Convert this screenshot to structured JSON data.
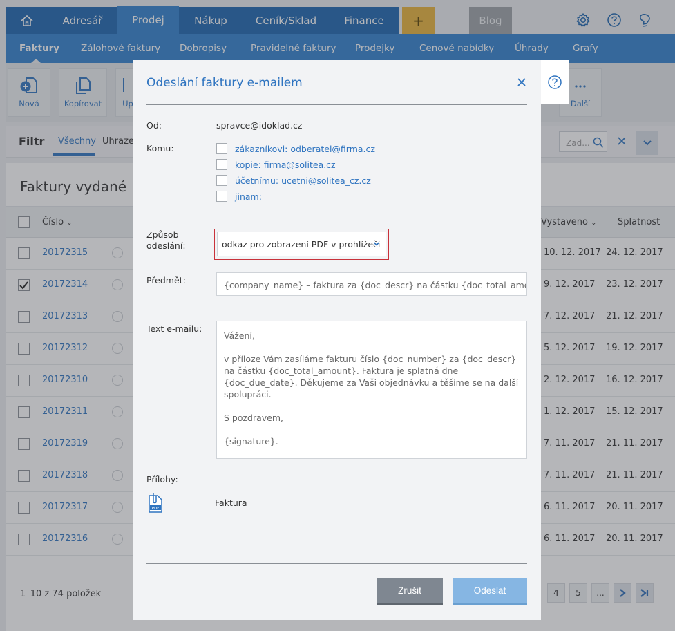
{
  "nav": {
    "home_icon": "home-icon",
    "items": [
      {
        "label": "Adresář"
      },
      {
        "label": "Prodej"
      },
      {
        "label": "Nákup"
      },
      {
        "label": "Ceník/Sklad"
      },
      {
        "label": "Finance"
      }
    ],
    "plus": "+",
    "blog": "Blog",
    "icons": [
      "gear-icon",
      "help-icon",
      "bulb-icon"
    ]
  },
  "subnav": {
    "items": [
      {
        "label": "Faktury"
      },
      {
        "label": "Zálohové faktury"
      },
      {
        "label": "Dobropisy"
      },
      {
        "label": "Pravidelné faktury"
      },
      {
        "label": "Prodejky"
      },
      {
        "label": "Cenové nabídky"
      },
      {
        "label": "Úhrady"
      },
      {
        "label": "Grafy"
      }
    ]
  },
  "toolbar": {
    "new_label": "Nová",
    "copy_label": "Kopírovat",
    "edit_label": "Up",
    "more_label": "Další"
  },
  "filter": {
    "title": "Filtr",
    "tab_all": "Všechny",
    "tab_paid": "Uhrazen",
    "search_placeholder": "Zad..."
  },
  "list": {
    "title": "Faktury vydané",
    "col_number": "Číslo",
    "col_issued": "Vystaveno",
    "col_due": "Splatnost",
    "rows": [
      {
        "number": "20172315",
        "issued": "10. 12. 2017",
        "due": "24. 12. 2017",
        "checked": false
      },
      {
        "number": "20172314",
        "issued": "9. 12. 2017",
        "due": "23. 12. 2017",
        "checked": true
      },
      {
        "number": "20172313",
        "issued": "7. 12. 2017",
        "due": "21. 12. 2017",
        "checked": false
      },
      {
        "number": "20172312",
        "issued": "5. 12. 2017",
        "due": "19. 12. 2017",
        "checked": false
      },
      {
        "number": "20172310",
        "issued": "2. 12. 2017",
        "due": "16. 12. 2017",
        "checked": false
      },
      {
        "number": "20172311",
        "issued": "1. 12. 2017",
        "due": "15. 12. 2017",
        "checked": false
      },
      {
        "number": "20172319",
        "issued": "7. 11. 2017",
        "due": "21. 11. 2017",
        "checked": false
      },
      {
        "number": "20172318",
        "issued": "7. 11. 2017",
        "due": "21. 11. 2017",
        "checked": false
      },
      {
        "number": "20172317",
        "issued": "6. 11. 2017",
        "due": "20. 11. 2017",
        "checked": false
      },
      {
        "number": "20172316",
        "issued": "6. 11. 2017",
        "due": "20. 11. 2017",
        "checked": false
      }
    ],
    "footer": "1–10 z 74 položek",
    "pages": [
      "4",
      "5",
      "..."
    ]
  },
  "dialog": {
    "title": "Odeslání faktury e-mailem",
    "from_label": "Od:",
    "from_value": "spravce@idoklad.cz",
    "to_label": "Komu:",
    "recipients": [
      {
        "label": "zákazníkovi: odberatel@firma.cz"
      },
      {
        "label": "kopie: firma@solitea.cz"
      },
      {
        "label": "účetnímu: ucetni@solitea_cz.cz"
      },
      {
        "label": "jinam:"
      }
    ],
    "method_label": "Způsob odeslání:",
    "method_value": "odkaz pro zobrazení PDF v prohlížeči",
    "subject_label": "Předmět:",
    "subject_value": "{company_name} – faktura za {doc_descr} na částku {doc_total_amount}",
    "body_label": "Text e-mailu:",
    "body_paragraphs": [
      "Vážení,",
      "v příloze Vám zasíláme fakturu číslo {doc_number} za {doc_descr} na částku {doc_total_amount}. Faktura je splatná dne {doc_due_date}. Děkujeme za Vaši objednávku a těšíme se na další spolupráci.",
      "S pozdravem,",
      "{signature}."
    ],
    "attachments_label": "Přílohy:",
    "attachment_name": "Faktura",
    "cancel_label": "Zrušit",
    "send_label": "Odeslat"
  }
}
